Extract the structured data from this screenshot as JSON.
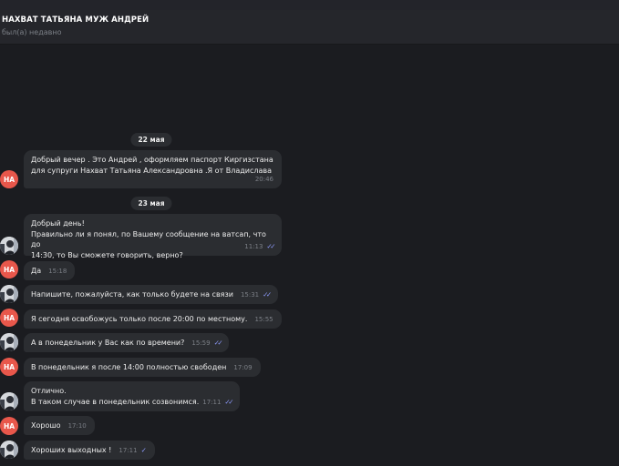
{
  "header": {
    "title": "НАХВАТ ТАТЬЯНА МУЖ АНДРЕЙ",
    "status": "был(а) недавно"
  },
  "dates": [
    "22 мая",
    "23 мая"
  ],
  "avatar_initials": "НА",
  "messages": [
    {
      "text": "Добрый вечер . Это Андрей , оформляем паспорт Киргизстана\nдля супруги Нахват Татьяна Александровна .Я от Владислава",
      "time": "20:46",
      "sender": "contact"
    },
    {
      "text": "Добрый день!\nПравильно ли я понял, по Вашему сообщение на ватсап, что до\n14:30, то Вы сможете говорить, верно?",
      "time": "11:13",
      "sender": "me",
      "check": "double"
    },
    {
      "text": "Да",
      "time": "15:18",
      "sender": "contact"
    },
    {
      "text": "Напишите, пожалуйста, как только будете на связи",
      "time": "15:31",
      "sender": "me",
      "check": "double"
    },
    {
      "text": "Я сегодня освобожусь только после 20:00 по местному.",
      "time": "15:55",
      "sender": "contact"
    },
    {
      "text": "А в понедельник у Вас как по времени?",
      "time": "15:59",
      "sender": "me",
      "check": "double"
    },
    {
      "text": "В понедельник я после 14:00 полностью свободен",
      "time": "17:09",
      "sender": "contact"
    },
    {
      "text": "Отлично.\nВ таком случае в понедельник созвонимся.",
      "time": "17:11",
      "sender": "me",
      "check": "double"
    },
    {
      "text": "Хорошо",
      "time": "17:10",
      "sender": "contact"
    },
    {
      "text": "Хороших выходных !",
      "time": "17:11",
      "sender": "me",
      "check": "single"
    }
  ],
  "colors": {
    "background": "#1b1c20",
    "bubble": "#2b2d31",
    "contact_avatar": "#e8574b",
    "read_check": "#8e9cff"
  }
}
